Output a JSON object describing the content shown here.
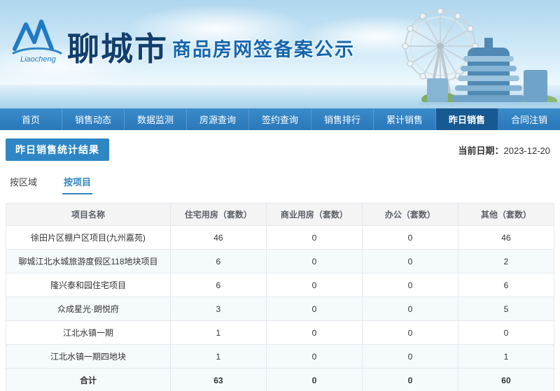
{
  "banner": {
    "logo_text": "Liaocheng",
    "site_name": "聊城市",
    "site_subtitle": "商品房网签备案公示"
  },
  "nav": {
    "items": [
      {
        "label": "首页",
        "active": false
      },
      {
        "label": "销售动态",
        "active": false
      },
      {
        "label": "数据监测",
        "active": false
      },
      {
        "label": "房源查询",
        "active": false
      },
      {
        "label": "签约查询",
        "active": false
      },
      {
        "label": "销售排行",
        "active": false
      },
      {
        "label": "累计销售",
        "active": false
      },
      {
        "label": "昨日销售",
        "active": true
      },
      {
        "label": "合同注销",
        "active": false
      }
    ]
  },
  "page": {
    "title": "昨日销售统计结果",
    "date_label": "当前日期：",
    "date_value": "2023-12-20"
  },
  "tabs": [
    {
      "label": "按区域",
      "active": false
    },
    {
      "label": "按项目",
      "active": true
    }
  ],
  "table": {
    "headers": [
      "项目名称",
      "住宅用房（套数）",
      "商业用房（套数）",
      "办公（套数）",
      "其他（套数）"
    ],
    "rows": [
      [
        "徐田片区棚户区项目(九州嘉苑)",
        "46",
        "0",
        "0",
        "46"
      ],
      [
        "聊城江北水城旅游度假区118地块项目",
        "6",
        "0",
        "0",
        "2"
      ],
      [
        "隆兴泰和园住宅项目",
        "6",
        "0",
        "0",
        "6"
      ],
      [
        "众成星光·朗悦府",
        "3",
        "0",
        "0",
        "5"
      ],
      [
        "江北水镇一期",
        "1",
        "0",
        "0",
        "0"
      ],
      [
        "江北水镇一期四地块",
        "1",
        "0",
        "0",
        "1"
      ],
      [
        "合计",
        "63",
        "0",
        "0",
        "60"
      ]
    ],
    "total_row_label": "合计"
  },
  "colors": {
    "accent": "#2e86c4",
    "nav_bg": "#2a78ba",
    "nav_active_bg": "#175993"
  }
}
